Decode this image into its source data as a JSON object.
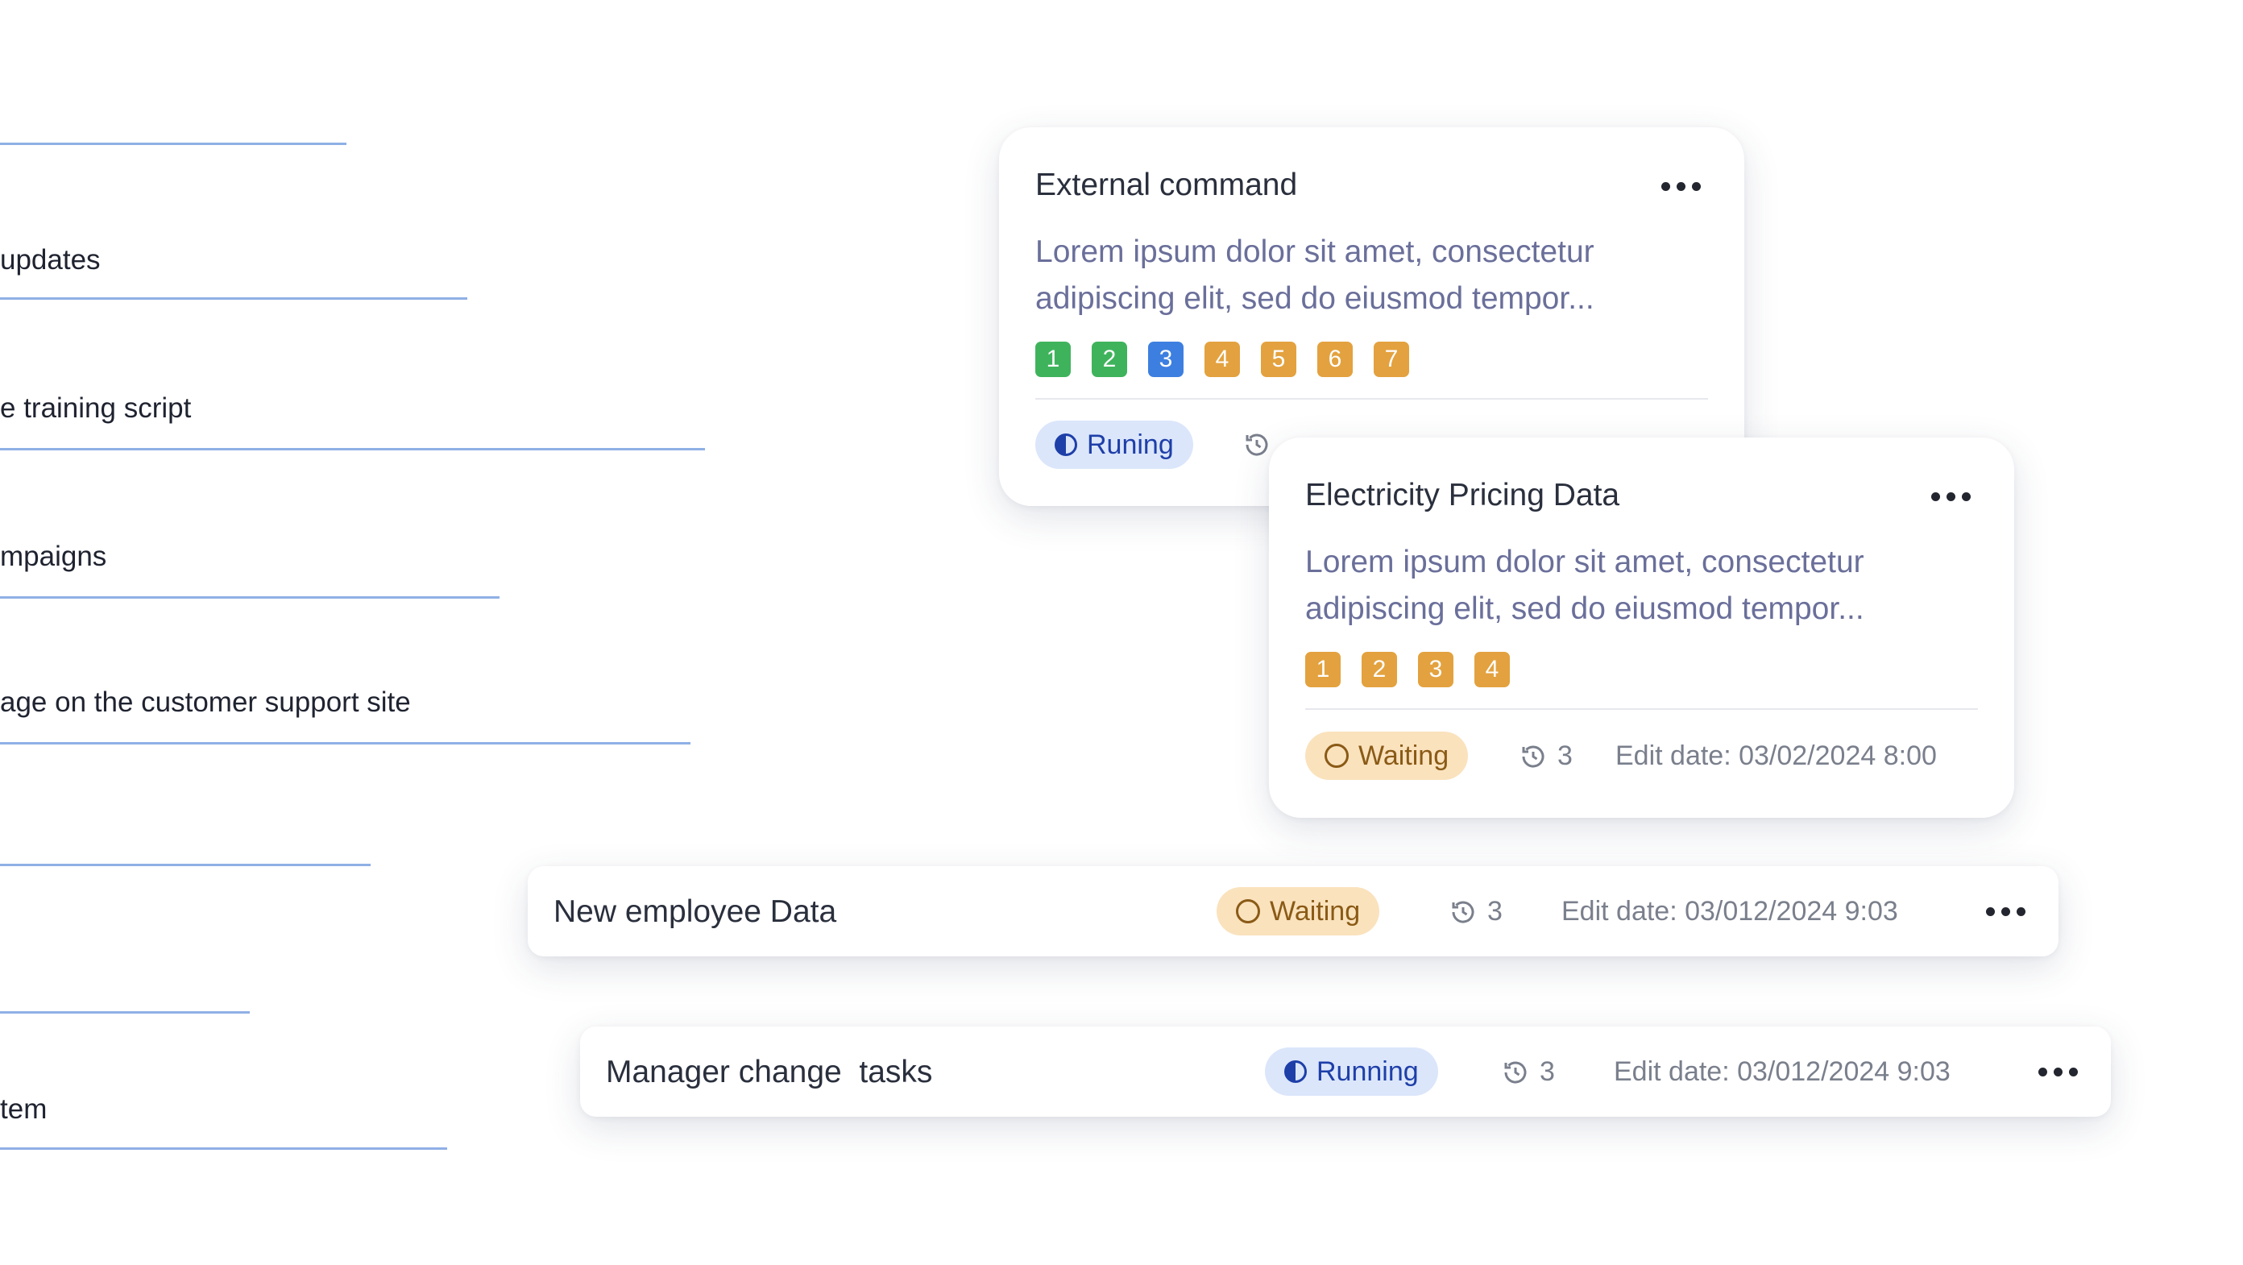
{
  "background_list": [
    {
      "text": ""
    },
    {
      "text": "updates"
    },
    {
      "text": "e training script"
    },
    {
      "text": "mpaigns"
    },
    {
      "text": "age on the customer support site"
    },
    {
      "text": ""
    },
    {
      "text": ""
    },
    {
      "text": "tem"
    }
  ],
  "card_external": {
    "title": "External command",
    "desc_line1": "Lorem ipsum dolor sit amet, consectetur",
    "desc_line2": "adipiscing elit, sed do eiusmod tempor...",
    "chips": [
      {
        "label": "1",
        "color": "#3fb35c"
      },
      {
        "label": "2",
        "color": "#3fb35c"
      },
      {
        "label": "3",
        "color": "#3d7fe0"
      },
      {
        "label": "4",
        "color": "#e3a23f"
      },
      {
        "label": "5",
        "color": "#e3a23f"
      },
      {
        "label": "6",
        "color": "#e3a23f"
      },
      {
        "label": "7",
        "color": "#e3a23f"
      }
    ],
    "status": "Runing"
  },
  "card_electricity": {
    "title": "Electricity Pricing Data",
    "desc_line1": "Lorem ipsum dolor sit amet, consectetur",
    "desc_line2": "adipiscing elit, sed do eiusmod tempor...",
    "chips": [
      {
        "label": "1",
        "color": "#e3a23f"
      },
      {
        "label": "2",
        "color": "#e3a23f"
      },
      {
        "label": "3",
        "color": "#e3a23f"
      },
      {
        "label": "4",
        "color": "#e3a23f"
      }
    ],
    "status": "Waiting",
    "history_count": "3",
    "edit_date": "Edit date: 03/02/2024 8:00"
  },
  "row_employee": {
    "title": "New employee Data",
    "status": "Waiting",
    "history_count": "3",
    "edit_date": "Edit date: 03/012/2024 9:03"
  },
  "row_manager": {
    "title": "Manager change  tasks",
    "status": "Running",
    "history_count": "3",
    "edit_date": "Edit date: 03/012/2024 9:03"
  }
}
